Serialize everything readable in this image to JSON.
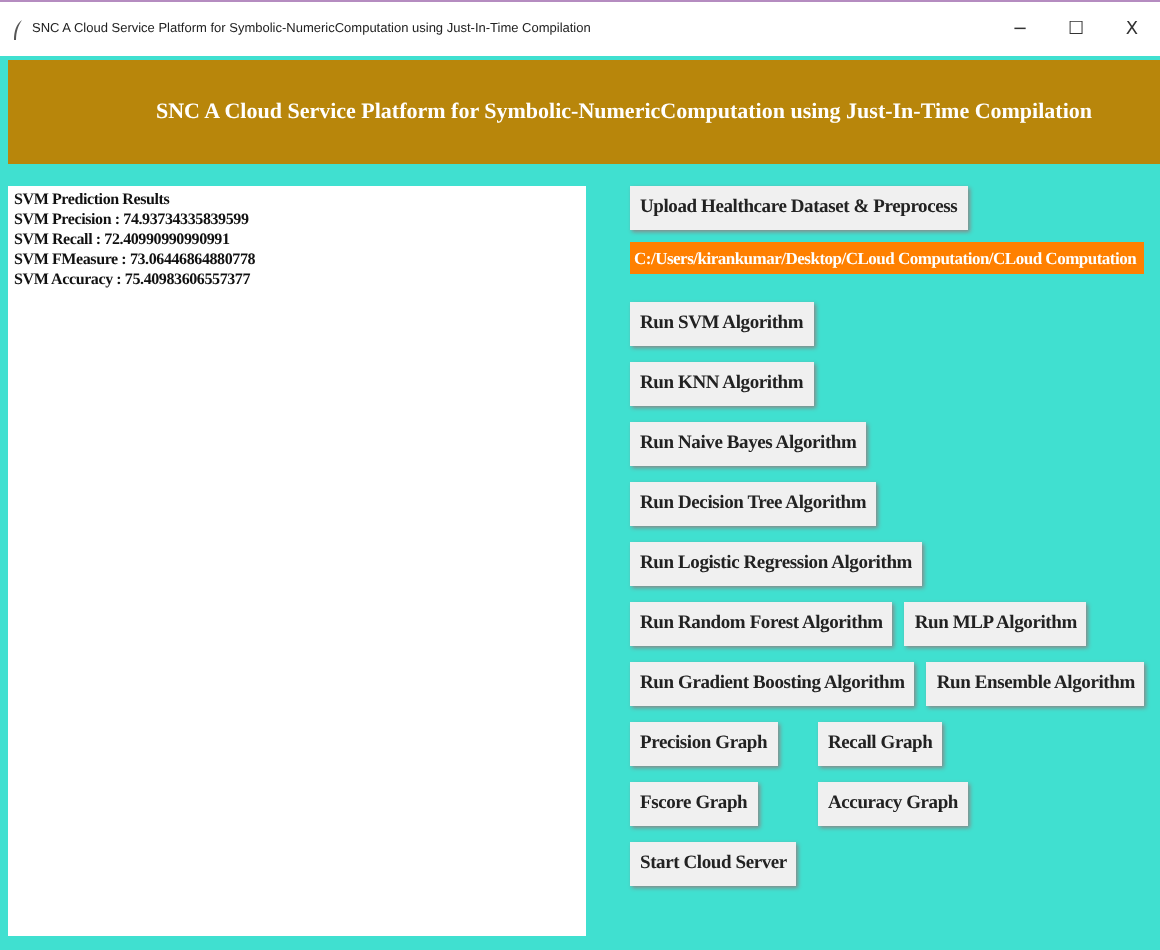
{
  "window": {
    "title": "SNC A Cloud Service Platform for Symbolic-NumericComputation using Just-In-Time Compilation",
    "controls": [
      "−",
      "☐",
      "X"
    ]
  },
  "header": {
    "title": "SNC A Cloud Service Platform for Symbolic-NumericComputation using Just-In-Time Compilation"
  },
  "output_text": [
    "SVM Prediction Results",
    "SVM Precision : 74.93734335839599",
    "SVM Recall : 72.40990990990991",
    "SVM FMeasure : 73.06446864880778",
    "SVM Accuracy : 75.40983606557377"
  ],
  "upload_button": "Upload Healthcare Dataset & Preprocess",
  "path_label": "C:/Users/kirankumar/Desktop/CLoud Computation/CLoud Computation",
  "button_rows": [
    {
      "kind": "single",
      "buttons": [
        "Run SVM Algorithm"
      ]
    },
    {
      "kind": "single",
      "buttons": [
        "Run KNN Algorithm"
      ]
    },
    {
      "kind": "single",
      "buttons": [
        "Run Naive Bayes Algorithm"
      ]
    },
    {
      "kind": "single",
      "buttons": [
        "Run Decision Tree Algorithm"
      ]
    },
    {
      "kind": "single",
      "buttons": [
        "Run Logistic Regression Algorithm"
      ]
    },
    {
      "kind": "pair",
      "buttons": [
        "Run Random Forest Algorithm",
        "Run MLP Algorithm"
      ]
    },
    {
      "kind": "pair",
      "buttons": [
        "Run Gradient Boosting Algorithm",
        "Run Ensemble Algorithm"
      ]
    },
    {
      "kind": "graph",
      "buttons": [
        "Precision Graph",
        "Recall Graph"
      ]
    },
    {
      "kind": "graph",
      "buttons": [
        "Fscore Graph",
        "Accuracy Graph"
      ]
    },
    {
      "kind": "single",
      "buttons": [
        "Start Cloud Server"
      ]
    }
  ]
}
